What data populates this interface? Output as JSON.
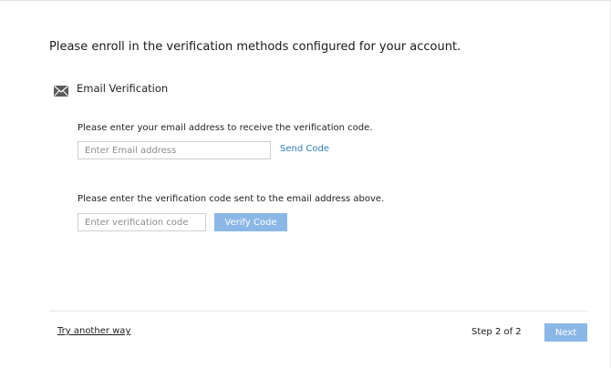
{
  "heading": "Please enroll in the verification methods configured for your account.",
  "method": {
    "icon": "mail-icon",
    "label": "Email Verification"
  },
  "email_step": {
    "instruction": "Please enter your email address to receive the verification code.",
    "placeholder": "Enter Email address",
    "value": "",
    "send_label": "Send Code"
  },
  "code_step": {
    "instruction": "Please enter the verification code sent to the email address above.",
    "placeholder": "Enter verification code",
    "value": "",
    "verify_label": "Verify Code"
  },
  "footer": {
    "alt_link": "Try another way",
    "step_text": "Step 2 of 2",
    "next_label": "Next"
  },
  "colors": {
    "button_bg": "#8bb7e6",
    "link": "#2a7fc4",
    "icon": "#5a5a5a"
  }
}
